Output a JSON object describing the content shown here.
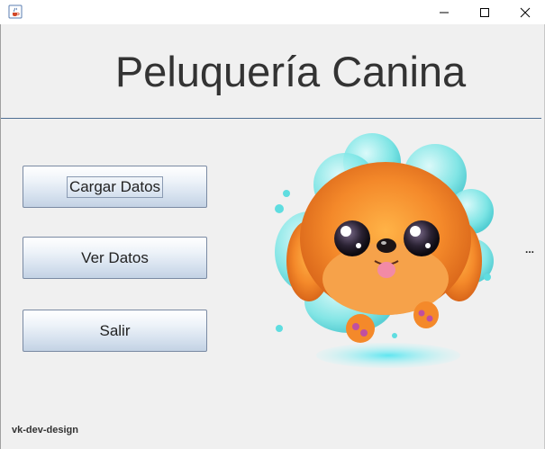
{
  "window": {
    "app_icon": "java-cup-icon",
    "controls": [
      "minimize-icon",
      "maximize-icon",
      "close-icon"
    ]
  },
  "header": {
    "title": "Peluquería Canina"
  },
  "menu": {
    "load_label": "Cargar Datos",
    "view_label": "Ver Datos",
    "exit_label": "Salir"
  },
  "side": {
    "ellipsis": "..."
  },
  "footer": {
    "credit": "vk-dev-design"
  },
  "image": {
    "subject": "cartoon-puppy-illustration"
  },
  "colors": {
    "separator": "#4f6f93",
    "button_top": "#ffffff",
    "button_bottom": "#c3d2e4"
  }
}
